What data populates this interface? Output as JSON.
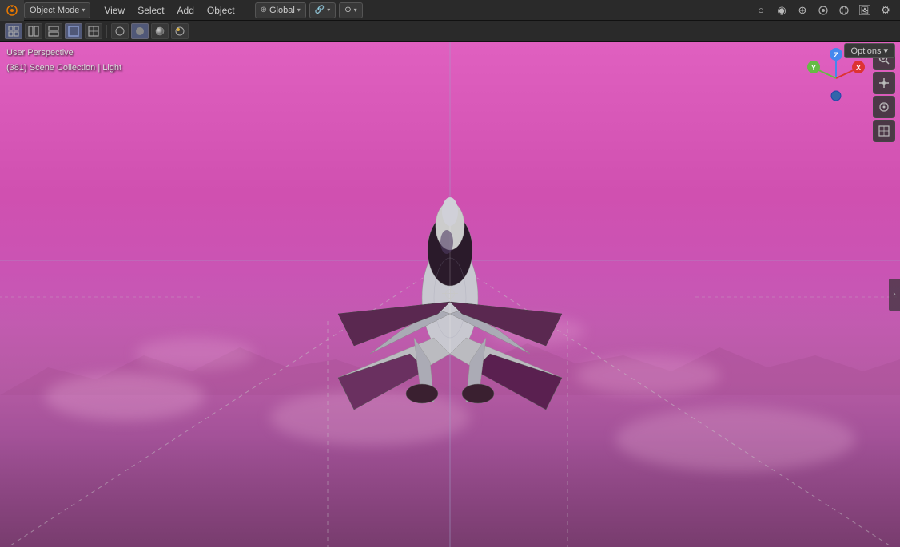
{
  "app": {
    "title": "Blender"
  },
  "menubar": {
    "mode_label": "Object Mode",
    "menu_items": [
      "View",
      "Select",
      "Add",
      "Object"
    ],
    "transform": "Global",
    "options_label": "Options"
  },
  "toolbar": {
    "buttons": [
      {
        "id": "icon-mode",
        "symbol": "⊞",
        "active": true
      },
      {
        "id": "icon-overlay",
        "symbol": "⬡",
        "active": false
      },
      {
        "id": "icon-xray",
        "symbol": "◑",
        "active": false
      },
      {
        "id": "icon-wireframe",
        "symbol": "⬜",
        "active": false
      },
      {
        "id": "icon-solid",
        "symbol": "●",
        "active": true
      },
      {
        "id": "icon-material",
        "symbol": "◕",
        "active": false
      },
      {
        "id": "icon-rendered",
        "symbol": "☀",
        "active": false
      }
    ]
  },
  "viewport": {
    "perspective_label": "User Perspective",
    "collection_label": "(381) Scene Collection | Light"
  },
  "nav_gizmo": {
    "x_color": "#e04040",
    "y_color": "#80c040",
    "z_color": "#4080e0",
    "dot_color": "#5080c0"
  },
  "right_tools": [
    {
      "id": "zoom-icon",
      "symbol": "🔍"
    },
    {
      "id": "pan-icon",
      "symbol": "✋"
    },
    {
      "id": "orbit-icon",
      "symbol": "🎥"
    },
    {
      "id": "grid-icon",
      "symbol": "⊞"
    }
  ],
  "icons": {
    "dropdown_arrow": "▾",
    "close_arrow": "›"
  }
}
